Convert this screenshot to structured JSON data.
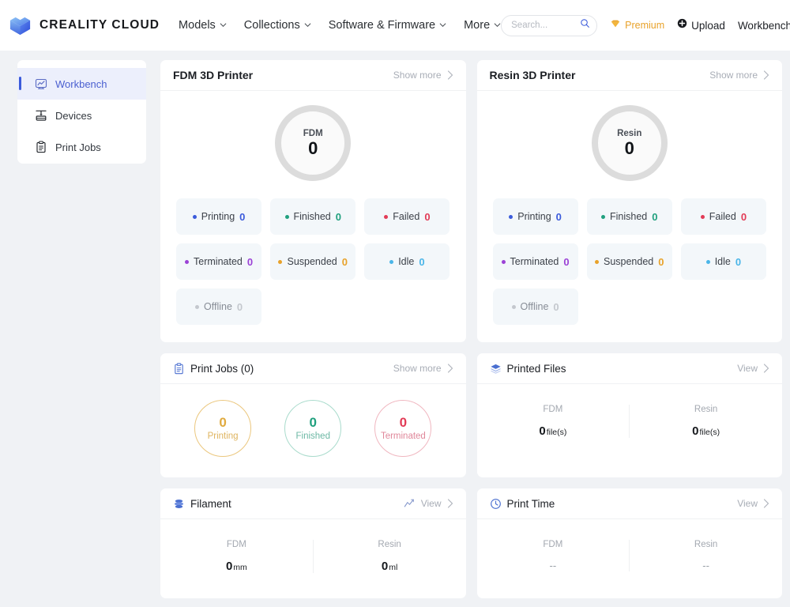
{
  "header": {
    "brand": "CREALITY CLOUD",
    "logo_icon": "creality-cube-logo",
    "nav": [
      {
        "label": "Models",
        "icon": "chevron-down-icon"
      },
      {
        "label": "Collections",
        "icon": "chevron-down-icon"
      },
      {
        "label": "Software & Firmware",
        "icon": "chevron-down-icon"
      },
      {
        "label": "More",
        "icon": "chevron-down-icon"
      }
    ],
    "search": {
      "value": "",
      "placeholder": "Search...",
      "icon": "search-icon"
    },
    "premium": {
      "label": "Premium",
      "icon": "diamond-icon",
      "color": "#e8a22a"
    },
    "upload": {
      "label": "Upload",
      "icon": "plus-circle-icon"
    },
    "workbench_link": "Workbench",
    "avatar": "user-avatar"
  },
  "sidebar": {
    "items": [
      {
        "label": "Workbench",
        "icon": "workbench-chart-icon",
        "active": true
      },
      {
        "label": "Devices",
        "icon": "printer-device-icon",
        "active": false
      },
      {
        "label": "Print Jobs",
        "icon": "clipboard-icon",
        "active": false
      }
    ]
  },
  "cards": {
    "fdm_printer": {
      "title": "FDM 3D Printer",
      "link": "Show more",
      "donut": {
        "label": "FDM",
        "value": "0",
        "ring_color": "#dcdcdc"
      },
      "chips": [
        {
          "label": "Printing",
          "value": "0",
          "color": "#3b5bdb"
        },
        {
          "label": "Finished",
          "value": "0",
          "color": "#20a07e"
        },
        {
          "label": "Failed",
          "value": "0",
          "color": "#e23b56"
        },
        {
          "label": "Terminated",
          "value": "0",
          "color": "#9b42d6"
        },
        {
          "label": "Suspended",
          "value": "0",
          "color": "#e8a22a"
        },
        {
          "label": "Idle",
          "value": "0",
          "color": "#4ab5e8"
        },
        {
          "label": "Offline",
          "value": "0",
          "color": "#c4c8ce"
        }
      ]
    },
    "resin_printer": {
      "title": "Resin 3D Printer",
      "link": "Show more",
      "donut": {
        "label": "Resin",
        "value": "0",
        "ring_color": "#dcdcdc"
      },
      "chips": [
        {
          "label": "Printing",
          "value": "0",
          "color": "#3b5bdb"
        },
        {
          "label": "Finished",
          "value": "0",
          "color": "#20a07e"
        },
        {
          "label": "Failed",
          "value": "0",
          "color": "#e23b56"
        },
        {
          "label": "Terminated",
          "value": "0",
          "color": "#9b42d6"
        },
        {
          "label": "Suspended",
          "value": "0",
          "color": "#e8a22a"
        },
        {
          "label": "Idle",
          "value": "0",
          "color": "#4ab5e8"
        },
        {
          "label": "Offline",
          "value": "0",
          "color": "#c4c8ce"
        }
      ]
    },
    "print_jobs": {
      "title": "Print Jobs (0)",
      "icon": "clipboard-icon",
      "link": "Show more",
      "rings": [
        {
          "label": "Printing",
          "value": "0",
          "color": "#e0aa3e"
        },
        {
          "label": "Finished",
          "value": "0",
          "color": "#20a07e"
        },
        {
          "label": "Terminated",
          "value": "0",
          "color": "#e23b56"
        }
      ]
    },
    "printed_files": {
      "title": "Printed Files",
      "icon": "layers-icon",
      "link": "View",
      "stats": [
        {
          "name": "FDM",
          "value": "0",
          "unit": "file(s)"
        },
        {
          "name": "Resin",
          "value": "0",
          "unit": "file(s)"
        }
      ]
    },
    "filament": {
      "title": "Filament",
      "icon": "filament-spool-icon",
      "link": "View",
      "link_icon": "line-chart-icon",
      "stats": [
        {
          "name": "FDM",
          "value": "0",
          "unit": "mm"
        },
        {
          "name": "Resin",
          "value": "0",
          "unit": "ml"
        }
      ]
    },
    "print_time": {
      "title": "Print Time",
      "icon": "clock-icon",
      "link": "View",
      "stats": [
        {
          "name": "FDM",
          "value": "--",
          "unit": ""
        },
        {
          "name": "Resin",
          "value": "--",
          "unit": ""
        }
      ]
    }
  }
}
